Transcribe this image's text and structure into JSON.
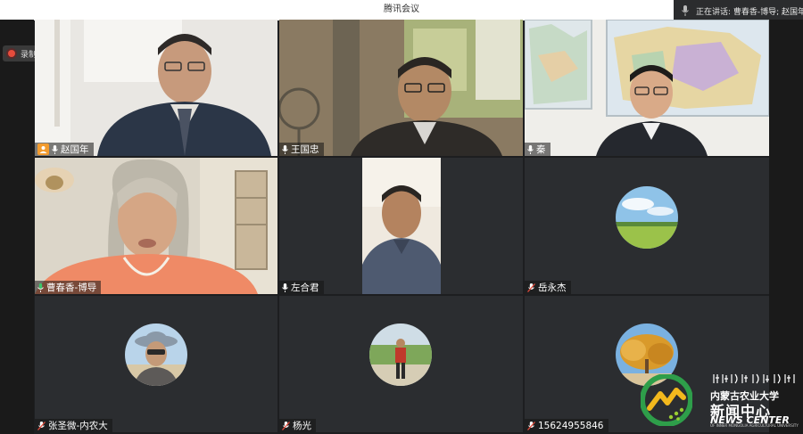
{
  "window": {
    "title": "腾讯会议",
    "speaking_label": "正在讲话: 曹春香-博导; 赵国年",
    "recording_label": "录制中"
  },
  "participants": [
    {
      "name": "赵国年",
      "is_host": true,
      "mic": "on",
      "video": true
    },
    {
      "name": "王国忠",
      "is_host": false,
      "mic": "on",
      "video": true
    },
    {
      "name": "秦",
      "is_host": false,
      "mic": "on",
      "video": true
    },
    {
      "name": "曹春香-博导",
      "is_host": false,
      "mic": "speaking",
      "video": true,
      "active_speaker": true
    },
    {
      "name": "左合君",
      "is_host": false,
      "mic": "on",
      "video": true
    },
    {
      "name": "岳永杰",
      "is_host": false,
      "mic": "muted",
      "video": false
    },
    {
      "name": "张圣微-内农大",
      "is_host": false,
      "mic": "muted",
      "video": false
    },
    {
      "name": "杨光",
      "is_host": false,
      "mic": "muted",
      "video": false
    },
    {
      "name": "15624955846",
      "is_host": false,
      "mic": "muted",
      "video": false
    }
  ],
  "watermark": {
    "school": "内蒙古农业大学",
    "center_cn": "新闻中心",
    "center_en": "NEWS CENTER",
    "small_en": "OF INNER MONGOLIA AGRICULTURAL UNIVERSITY"
  },
  "colors": {
    "host_badge": "#f29b2e",
    "speaking_mic": "#3cc56b",
    "muted_mic": "#e74c3c",
    "tile_bg": "#2b2d30"
  }
}
